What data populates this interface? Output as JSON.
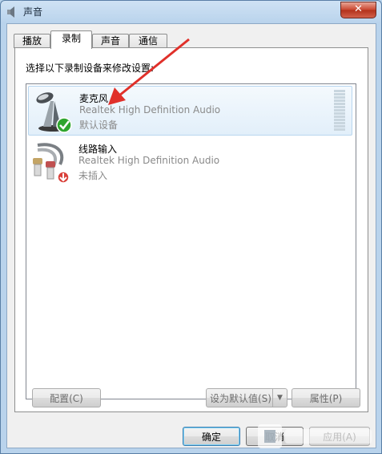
{
  "window": {
    "title": "声音",
    "close_glyph": "✕"
  },
  "tabs": [
    {
      "label": "播放",
      "active": false
    },
    {
      "label": "录制",
      "active": true
    },
    {
      "label": "声音",
      "active": false
    },
    {
      "label": "通信",
      "active": false
    }
  ],
  "panel": {
    "instruction": "选择以下录制设备来修改设置:"
  },
  "devices": [
    {
      "name": "麦克风",
      "driver": "Realtek High Definition Audio",
      "status": "默认设备",
      "icon": "microphone-icon",
      "badge": "default-check-icon",
      "selected": true
    },
    {
      "name": "线路输入",
      "driver": "Realtek High Definition Audio",
      "status": "未插入",
      "icon": "line-in-cable-icon",
      "badge": "unplugged-down-arrow-icon",
      "selected": false
    }
  ],
  "buttons": {
    "configure": "配置(C)",
    "set_default": "设为默认值(S)",
    "properties": "属性(P)",
    "ok": "确定",
    "cancel": "取消",
    "apply": "应用(A)"
  },
  "colors": {
    "accent_arrow": "#e0302a",
    "check_green": "#2ea52e",
    "selection": "#e2effa"
  }
}
